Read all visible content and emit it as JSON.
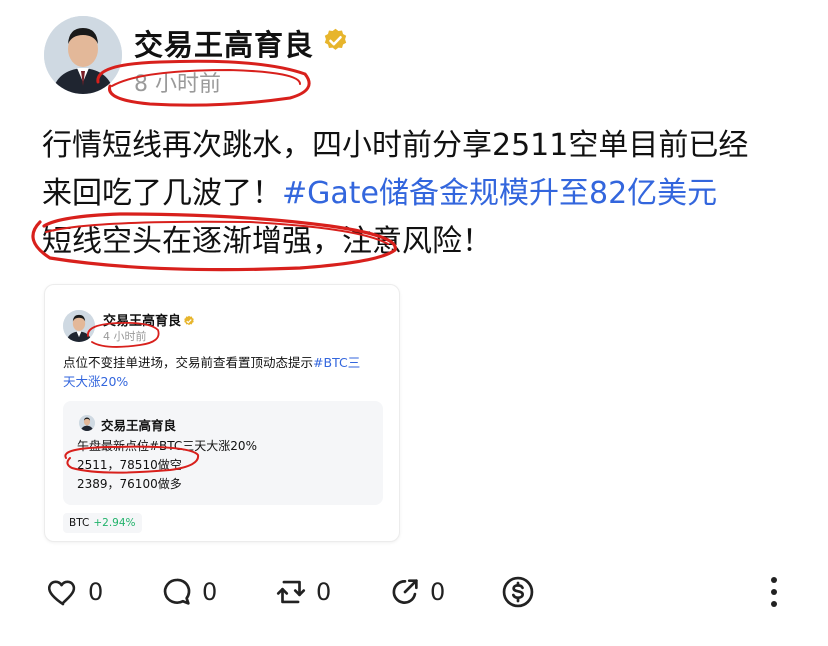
{
  "post": {
    "author": "交易王高育良",
    "timestamp": "8 小时前",
    "lines": {
      "l1": "行情短线再次跳水，四小时前分享2511空单目前已经",
      "l2_pre": "来回吃了几波了！",
      "l2_hashtag": "#Gate储备金规模升至82亿美元",
      "l3": "短线空头在逐渐增强，注意风险！"
    }
  },
  "quoted": {
    "author": "交易王高育良",
    "timestamp": "4 小时前",
    "text_l1_pre": "点位不变挂单进场，交易前查看置顶动态提示",
    "text_l1_hashtag": "#BTC三",
    "text_l2_hashtag": "天大涨20%",
    "inner": {
      "author": "交易王高育良",
      "l1": "午盘最新点位#BTC三天大涨20%",
      "l2": "2511，78510做空",
      "l3": "2389，76100做多"
    },
    "ticker": {
      "symbol": "BTC",
      "change": "+2.94%"
    }
  },
  "actions": {
    "like_count": "0",
    "comment_count": "0",
    "repost_count": "0",
    "share_count": "0"
  },
  "icons": {
    "verified": "verified-badge-icon",
    "like": "heart-icon",
    "comment": "comment-bubble-icon",
    "repost": "repost-icon",
    "share": "share-arrow-icon",
    "tip": "dollar-coin-icon",
    "more": "more-vertical-icon"
  },
  "colors": {
    "hashtag": "#3366dd",
    "verified_badge": "#e7b52c",
    "annotation_red": "#d8201c",
    "ticker_positive": "#22b36b"
  }
}
